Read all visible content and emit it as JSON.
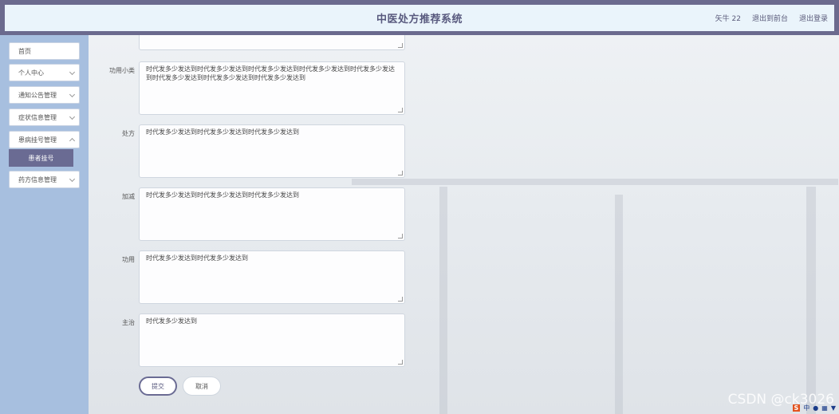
{
  "header": {
    "title": "中医处方推荐系统",
    "user": "矢牛 22",
    "back_to_front": "退出到前台",
    "logout": "退出登录"
  },
  "sidebar": {
    "items": [
      {
        "label": "首页"
      },
      {
        "label": "个人中心"
      },
      {
        "label": "通知公告管理"
      },
      {
        "label": "症状信息管理"
      },
      {
        "label": "患病挂号管理"
      },
      {
        "label": "患者挂号"
      },
      {
        "label": "药方信息管理"
      }
    ]
  },
  "form": {
    "fields": [
      {
        "label": "功用小类",
        "value": "时代发多少发达到时代发多少发达到时代发多少发达到时代发多少发达到时代发多少发达到时代发多少发达到时代发多少发达到时代发多少发达到"
      },
      {
        "label": "处方",
        "value": "时代发多少发达到时代发多少发达到时代发多少发达到"
      },
      {
        "label": "加减",
        "value": "时代发多少发达到时代发多少发达到时代发多少发达到"
      },
      {
        "label": "功用",
        "value": "时代发多少发达到时代发多少发达到"
      },
      {
        "label": "主治",
        "value": "时代发多少发达到"
      }
    ],
    "submit_label": "提交",
    "cancel_label": "取消"
  },
  "watermark": "CSDN @ck3026",
  "ime": {
    "logo": "S",
    "lang": "中"
  }
}
